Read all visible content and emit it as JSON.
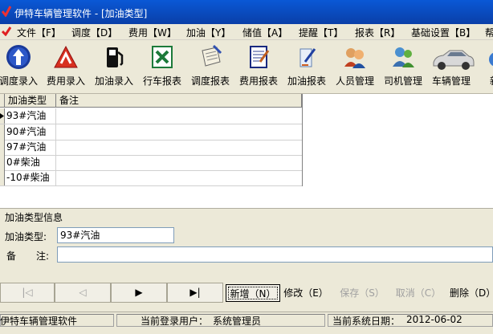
{
  "window": {
    "title": "伊特车辆管理软件 - [加油类型]"
  },
  "menu": {
    "items": [
      "文件【F】",
      "调度【D】",
      "费用【W】",
      "加油【Y】",
      "储值【A】",
      "提醒【T】",
      "报表【R】",
      "基础设置【B】",
      "帮"
    ]
  },
  "toolbar": {
    "buttons": [
      {
        "label": "调度录入",
        "icon": "up-arrow-icon"
      },
      {
        "label": "费用录入",
        "icon": "warning-icon"
      },
      {
        "label": "加油录入",
        "icon": "fuel-pump-icon"
      },
      {
        "label": "行车报表",
        "icon": "excel-icon"
      },
      {
        "label": "调度报表",
        "icon": "scroll-icon"
      },
      {
        "label": "费用报表",
        "icon": "notepad-icon"
      },
      {
        "label": "加油报表",
        "icon": "pen-doc-icon"
      },
      {
        "label": "人员管理",
        "icon": "people-icon"
      },
      {
        "label": "司机管理",
        "icon": "driver-icon"
      },
      {
        "label": "车辆管理",
        "icon": "car-icon"
      },
      {
        "label": "新",
        "icon": "globe-icon"
      }
    ]
  },
  "grid": {
    "columns": [
      "加油类型",
      "备注"
    ],
    "rows": [
      {
        "type": "93#汽油",
        "note": ""
      },
      {
        "type": "90#汽油",
        "note": ""
      },
      {
        "type": "97#汽油",
        "note": ""
      },
      {
        "type": "0#柴油",
        "note": ""
      },
      {
        "type": "-10#柴油",
        "note": ""
      }
    ]
  },
  "info": {
    "group_title": "加油类型信息",
    "type_label": "加油类型:",
    "type_value": "93#汽油",
    "note_label_1": "备",
    "note_label_2": "注:",
    "note_value": ""
  },
  "nav": {
    "first": "|◁",
    "prev": "◁",
    "next": "▶",
    "last": "▶|"
  },
  "actions": {
    "add": "新增（N）",
    "edit": "修改（E）",
    "save": "保存（S）",
    "cancel": "取消（C）",
    "delete": "删除（D）"
  },
  "status": {
    "app": "伊特车辆管理软件",
    "user_label": "当前登录用户：",
    "user_value": "系统管理员",
    "date_label": "当前系统日期：",
    "date_value": "2012-06-02"
  },
  "colors": {
    "titlebar": "#0a4cc8",
    "background": "#ece9d8"
  }
}
